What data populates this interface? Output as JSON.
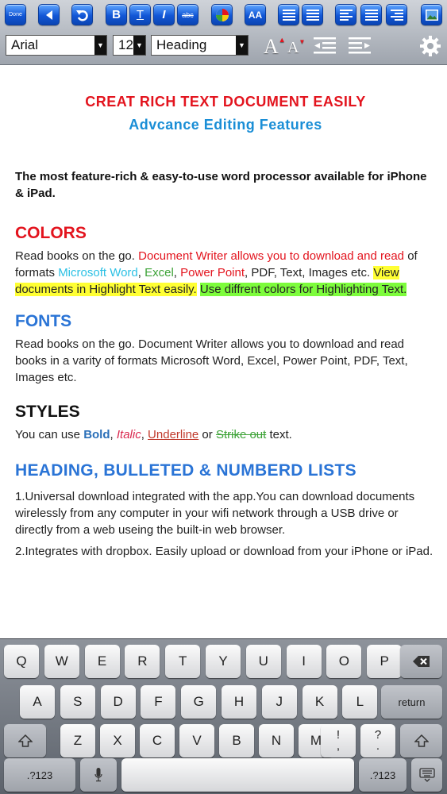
{
  "toolbar": {
    "done_label": "Done",
    "bold_label": "B",
    "underline_label": "T",
    "italic_label": "I",
    "strike_label": "abc",
    "case_label": "AA",
    "font_family": "Arial",
    "font_size": "12",
    "paragraph_style": "Heading",
    "grow_font_label": "A",
    "shrink_font_label": "A"
  },
  "document": {
    "title": "CREAT RICH TEXT DOCUMENT EASILY",
    "subtitle": "Advcance Editing Features",
    "intro": "The most feature-rich & easy-to-use word processor available for iPhone & iPad.",
    "colors": {
      "heading": "COLORS",
      "t1": "Read books on the go. ",
      "t2": "Document Writer allows you to download and read",
      "t3": " of formats ",
      "t4": "Microsoft Word",
      "t5": ", ",
      "t6": "Excel",
      "t7": ", ",
      "t8": "Power Point",
      "t9": ", PDF, Text, Images etc. ",
      "t10": "View documents in Highlight Text easily.",
      "t11": " ",
      "t12": "Use diffrent colors for Highlighting Text."
    },
    "fonts": {
      "heading": "FONTS",
      "body": "Read books on the go. Document Writer allows you to download and read books in a varity of formats Microsoft Word, Excel, Power Point, PDF, Text, Images etc."
    },
    "styles": {
      "heading": "STYLES",
      "t1": "You can use ",
      "bold": "Bold",
      "t2": ", ",
      "italic": "Italic",
      "t3": ", ",
      "underline": "Underline",
      "t4": " or ",
      "strike": "Strike out",
      "t5": " text."
    },
    "lists": {
      "heading": "HEADING, BULLETED & NUMBERD LISTS",
      "item1": "1.Universal download integrated with the app.You can download documents wirelessly from any computer in your wifi network through a USB drive or directly from a web useing the built-in web browser.",
      "item2": "2.Integrates with dropbox. Easily upload or download from your iPhone or iPad."
    }
  },
  "keyboard": {
    "row1": [
      "Q",
      "W",
      "E",
      "R",
      "T",
      "Y",
      "U",
      "I",
      "O",
      "P"
    ],
    "row2": [
      "A",
      "S",
      "D",
      "F",
      "G",
      "H",
      "J",
      "K",
      "L"
    ],
    "row3": [
      "Z",
      "X",
      "C",
      "V",
      "B",
      "N",
      "M"
    ],
    "return_label": "return",
    "num_label": ".?123",
    "exclaim_top": "!",
    "exclaim_bottom": ",",
    "question_top": "?",
    "question_bottom": "."
  }
}
